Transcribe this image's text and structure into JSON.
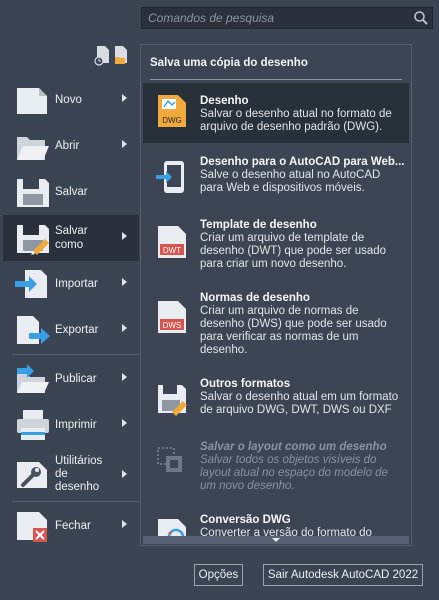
{
  "search": {
    "placeholder": "Comandos de pesquisa",
    "icon": "search-icon"
  },
  "menu": {
    "items": [
      {
        "label": "Novo",
        "has_submenu": true
      },
      {
        "label": "Abrir",
        "has_submenu": true
      },
      {
        "label": "Salvar",
        "has_submenu": false
      },
      {
        "label_line1": "Salvar",
        "label_line2": "como",
        "has_submenu": true
      },
      {
        "label": "Importar",
        "has_submenu": true
      },
      {
        "label": "Exportar",
        "has_submenu": true
      },
      {
        "label": "Publicar",
        "has_submenu": true
      },
      {
        "label": "Imprimir",
        "has_submenu": true
      },
      {
        "label_line1": "Utilitários",
        "label_line2": "de",
        "label_line3": "desenho",
        "has_submenu": true
      },
      {
        "label": "Fechar",
        "has_submenu": true
      }
    ]
  },
  "panel": {
    "title": "Salva uma cópia do desenho",
    "options": [
      {
        "title": "Desenho",
        "line1": "Salvar o desenho atual no formato de",
        "line2": "arquivo de desenho padrão (DWG).",
        "icon_text": "DWG"
      },
      {
        "title": "Desenho para o AutoCAD para Web...",
        "line1": "Salve o desenho atual no AutoCAD",
        "line2": "para Web e dispositivos móveis."
      },
      {
        "title": "Template de desenho",
        "line1": "Criar um arquivo de template de",
        "line2": "desenho (DWT) que pode ser usado",
        "line3": "para criar um novo desenho.",
        "icon_text": "DWT"
      },
      {
        "title": "Normas de desenho",
        "line1": "Criar um arquivo de normas de",
        "line2": "desenho (DWS) que pode ser usado",
        "line3": "para verificar as normas de um",
        "line4": "desenho.",
        "icon_text": "DWS"
      },
      {
        "title": "Outros formatos",
        "line1": "Salvar o desenho atual em um formato",
        "line2": "de arquivo DWG, DWT, DWS ou DXF"
      },
      {
        "title": "Salvar o layout como um desenho",
        "line1": "Salvar todos os objetos visíveis do",
        "line2": "layout atual no espaço do modelo de",
        "line3": "um novo desenho."
      },
      {
        "title": "Conversão DWG",
        "line1": "Converter a versão do formato do"
      }
    ]
  },
  "footer": {
    "options_label": "Opções",
    "exit_label": "Sair Autodesk AutoCAD 2022"
  },
  "colors": {
    "accent": "#f2a93b",
    "blue": "#3aa0e6",
    "red": "#d9534f",
    "bg": "#3b4453",
    "selected": "#283039"
  }
}
